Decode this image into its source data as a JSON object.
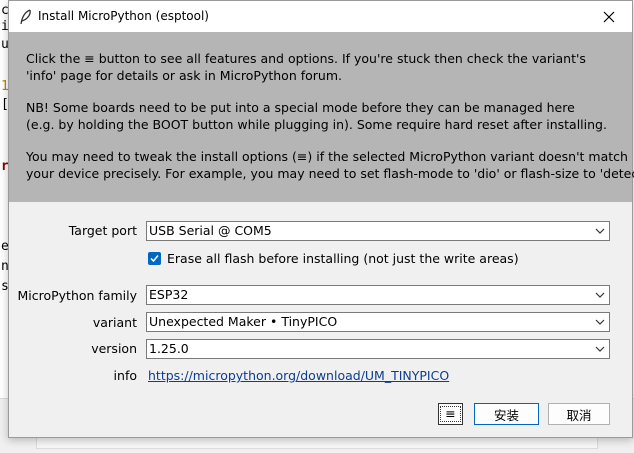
{
  "background": {
    "lines": [
      "c",
      "i",
      "u",
      "1",
      "[",
      "r",
      "e",
      "n",
      "s"
    ]
  },
  "dialog": {
    "title": "Install MicroPython (esptool)",
    "title_icon": "feather-icon",
    "close_icon": "close-icon",
    "info_paragraphs": [
      "Click the ≡ button to see all features and options. If you're stuck then check the variant's\n'info' page for details or ask in MicroPython forum.",
      "NB! Some boards need to be put into a special mode before they can be managed here\n(e.g. by holding the BOOT button while plugging in). Some require hard reset after installing.",
      "You may need to tweak the install options (≡) if the selected MicroPython variant doesn't match\nyour device precisely. For example, you may need to set flash-mode to 'dio' or flash-size to 'detect'."
    ],
    "target_port": {
      "label": "Target port",
      "value": "USB Serial @ COM5"
    },
    "erase_flash": {
      "label": "Erase all flash before installing (not just the write areas)",
      "checked": true
    },
    "family": {
      "label": "MicroPython family",
      "value": "ESP32"
    },
    "variant": {
      "label": "variant",
      "value": "Unexpected Maker • TinyPICO"
    },
    "version": {
      "label": "version",
      "value": "1.25.0"
    },
    "info": {
      "label": "info",
      "link": "https://micropython.org/download/UM_TINYPICO"
    },
    "buttons": {
      "menu": "≡",
      "install": "安装",
      "cancel": "取消"
    },
    "colors": {
      "accent": "#0067c0",
      "info_bg": "#b5b5b5",
      "dialog_bg": "#f0f0f0",
      "link": "#0b3d91"
    }
  }
}
